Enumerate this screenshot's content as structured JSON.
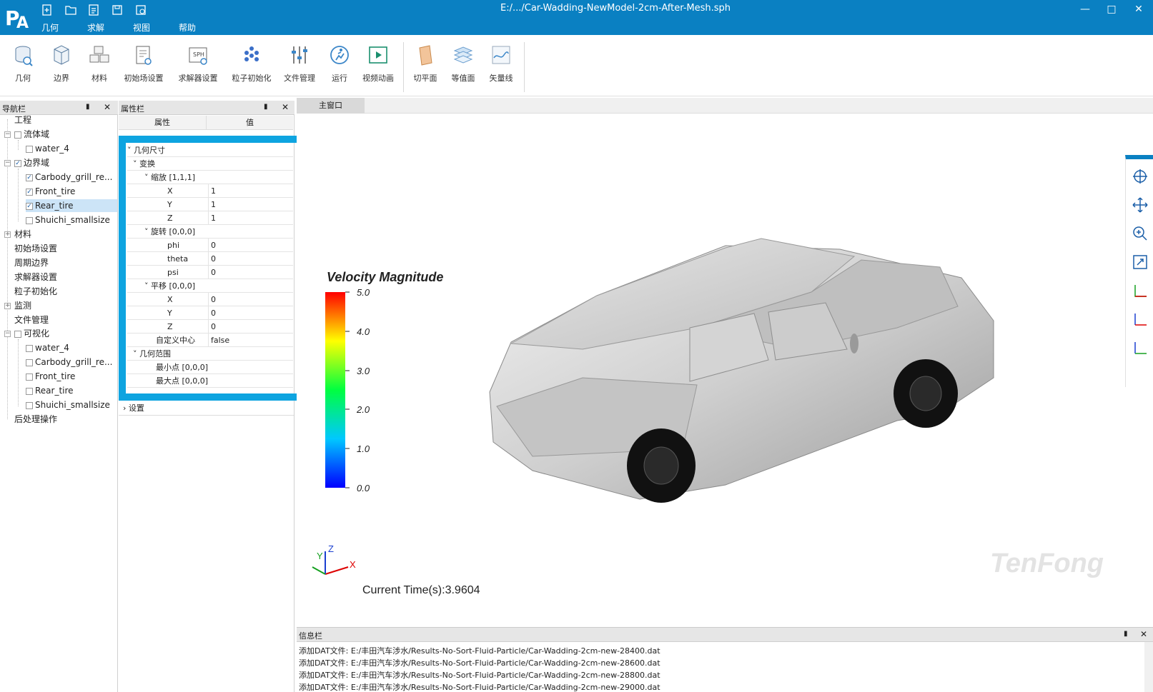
{
  "window": {
    "title": "E:/.../Car-Wadding-NewModel-2cm-After-Mesh.sph",
    "logo_text": "PA",
    "minimize": "—",
    "maximize": "□",
    "close": "✕"
  },
  "menu": [
    "几何",
    "求解",
    "视图",
    "帮助"
  ],
  "ribbon": [
    {
      "label": "几何",
      "icon": "geometry-icon"
    },
    {
      "label": "边界",
      "icon": "boundary-icon"
    },
    {
      "label": "材料",
      "icon": "material-icon"
    },
    {
      "label": "初始场设置",
      "icon": "initial-field-icon"
    },
    {
      "label": "求解器设置",
      "icon": "solver-settings-icon"
    },
    {
      "label": "粒子初始化",
      "icon": "particle-init-icon"
    },
    {
      "label": "文件管理",
      "icon": "file-manage-icon"
    },
    {
      "label": "运行",
      "icon": "run-icon"
    },
    {
      "label": "视频动画",
      "icon": "video-icon"
    },
    {
      "label": "切平面",
      "icon": "cut-plane-icon"
    },
    {
      "label": "等值面",
      "icon": "isosurface-icon"
    },
    {
      "label": "矢量线",
      "icon": "vector-line-icon"
    }
  ],
  "nav": {
    "title": "导航栏",
    "items": [
      {
        "label": "工程"
      },
      {
        "label": "流体域"
      },
      {
        "label": "water_4"
      },
      {
        "label": "边界域"
      },
      {
        "label": "Carbody_grill_re..."
      },
      {
        "label": "Front_tire"
      },
      {
        "label": "Rear_tire"
      },
      {
        "label": "Shuichi_smallsize"
      },
      {
        "label": "材料"
      },
      {
        "label": "初始场设置"
      },
      {
        "label": "周期边界"
      },
      {
        "label": "求解器设置"
      },
      {
        "label": "粒子初始化"
      },
      {
        "label": "监测"
      },
      {
        "label": "文件管理"
      },
      {
        "label": "可视化"
      },
      {
        "label": "water_4"
      },
      {
        "label": "Carbody_grill_re..."
      },
      {
        "label": "Front_tire"
      },
      {
        "label": "Rear_tire"
      },
      {
        "label": "Shuichi_smallsize"
      },
      {
        "label": "后处理操作"
      }
    ]
  },
  "props": {
    "title": "属性栏",
    "col_prop": "属性",
    "col_value": "值",
    "rows": [
      {
        "k": "几何尺寸",
        "v": ""
      },
      {
        "k": "变换",
        "v": ""
      },
      {
        "k": "缩放 [1,1,1]",
        "v": ""
      },
      {
        "k": "X",
        "v": "1"
      },
      {
        "k": "Y",
        "v": "1"
      },
      {
        "k": "Z",
        "v": "1"
      },
      {
        "k": "旋转 [0,0,0]",
        "v": ""
      },
      {
        "k": "phi",
        "v": "0"
      },
      {
        "k": "theta",
        "v": "0"
      },
      {
        "k": "psi",
        "v": "0"
      },
      {
        "k": "平移 [0,0,0]",
        "v": ""
      },
      {
        "k": "X",
        "v": "0"
      },
      {
        "k": "Y",
        "v": "0"
      },
      {
        "k": "Z",
        "v": "0"
      },
      {
        "k": "自定义中心",
        "v": "false"
      },
      {
        "k": "几何范围",
        "v": ""
      },
      {
        "k": "最小点 [0,0,0]",
        "v": ""
      },
      {
        "k": "最大点 [0,0,0]",
        "v": ""
      }
    ],
    "settings": "设置"
  },
  "main": {
    "tab": "主窗口",
    "legend_title": "Velocity Magnitude",
    "legend_ticks": [
      "5.0",
      "4.0",
      "3.0",
      "2.0",
      "1.0",
      "0.0"
    ],
    "current_time": "Current Time(s):3.9604",
    "watermark": "TenFong",
    "axes": {
      "x": "X",
      "y": "Y",
      "z": "Z"
    }
  },
  "info": {
    "title": "信息栏",
    "lines": [
      "添加DAT文件: E:/丰田汽车涉水/Results-No-Sort-Fluid-Particle/Car-Wadding-2cm-new-28400.dat",
      "添加DAT文件: E:/丰田汽车涉水/Results-No-Sort-Fluid-Particle/Car-Wadding-2cm-new-28600.dat",
      "添加DAT文件: E:/丰田汽车涉水/Results-No-Sort-Fluid-Particle/Car-Wadding-2cm-new-28800.dat",
      "添加DAT文件: E:/丰田汽车涉水/Results-No-Sort-Fluid-Particle/Car-Wadding-2cm-new-29000.dat"
    ]
  },
  "colors": {
    "titlebar": "#0a80c2",
    "highlight": "#0ea4e0",
    "selected": "#cce4f7"
  }
}
